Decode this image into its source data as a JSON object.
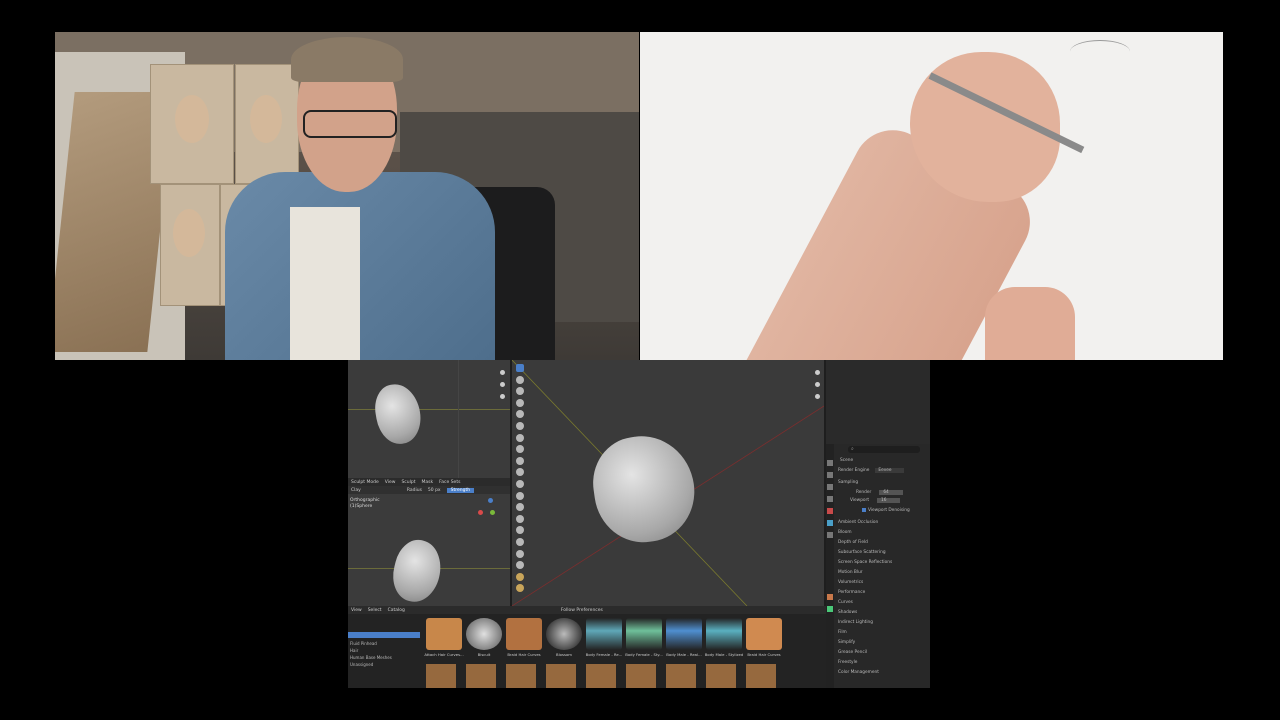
{
  "blender": {
    "viewport_top_left": {
      "label": ""
    },
    "sculpt_header": {
      "mode": "Sculpt Mode",
      "menus": [
        "View",
        "Sculpt",
        "Mask",
        "Face Sets"
      ],
      "brush": "Clay",
      "radius_label": "Radius",
      "radius_value": "50 px",
      "strength_label": "Strength"
    },
    "ortho_label": "Orthographic",
    "ortho_sub": "(1)Sphere",
    "asset_browser": {
      "menus": [
        "View",
        "Select",
        "Catalog"
      ],
      "library": "Follow Preferences",
      "catalogs": [
        "Fluid Pinhead",
        "Hair",
        "Human Base Meshes",
        "Unassigned"
      ],
      "assets": [
        {
          "label": "Attach Hair Curves...",
          "color": "#c8874a"
        },
        {
          "label": "Biscuit",
          "color": "#d0d0d0"
        },
        {
          "label": "Braid Hair Curves",
          "color": "#b27140"
        },
        {
          "label": "Blossom",
          "color": "#3a3a3a"
        },
        {
          "label": "Body Female - Re...",
          "color": "#5fa8b8"
        },
        {
          "label": "Body Female - Sty...",
          "color": "#6fc09a"
        },
        {
          "label": "Body Male - Real...",
          "color": "#4f8fd0"
        },
        {
          "label": "Body Male - Stylized",
          "color": "#5ab0c0"
        },
        {
          "label": "Braid Hair Curves",
          "color": "#d08a50"
        }
      ]
    },
    "properties": {
      "search_icon": "search-icon",
      "scene_label": "Scene",
      "render_engine_label": "Render Engine",
      "render_engine_value": "Eevee",
      "sampling": "Sampling",
      "render_label": "Render",
      "render_value": "64",
      "viewport_label": "Viewport",
      "viewport_value": "16",
      "viewport_denoising": "Viewport Denoising",
      "panels": [
        "Ambient Occlusion",
        "Bloom",
        "Depth of Field",
        "Subsurface Scattering",
        "Screen Space Reflections",
        "Motion Blur",
        "Volumetrics",
        "Performance",
        "Curves",
        "Shadows",
        "Indirect Lighting",
        "Film",
        "Simplify",
        "Grease Pencil",
        "Freestyle",
        "Color Management"
      ]
    }
  }
}
